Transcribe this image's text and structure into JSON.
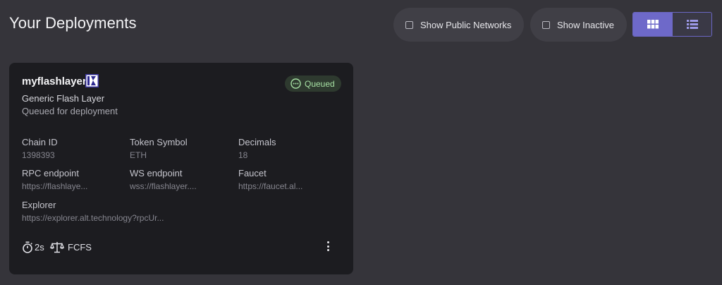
{
  "header": {
    "title": "Your Deployments",
    "show_public_label": "Show Public Networks",
    "show_inactive_label": "Show Inactive"
  },
  "card": {
    "name": "myflashlayer",
    "type": "Generic Flash Layer",
    "status_text": "Queued for deployment",
    "badge": "Queued",
    "fields": {
      "chain_id": {
        "label": "Chain ID",
        "value": "1398393"
      },
      "token_symbol": {
        "label": "Token Symbol",
        "value": "ETH"
      },
      "decimals": {
        "label": "Decimals",
        "value": "18"
      },
      "rpc": {
        "label": "RPC endpoint",
        "value": "https://flashlaye..."
      },
      "ws": {
        "label": "WS endpoint",
        "value": "wss://flashlayer...."
      },
      "faucet": {
        "label": "Faucet",
        "value": "https://faucet.al..."
      },
      "explorer": {
        "label": "Explorer",
        "value": "https://explorer.alt.technology?rpcUr..."
      }
    },
    "footer": {
      "block_time": "2s",
      "sequencing": "FCFS"
    }
  },
  "colors": {
    "background": "#35343a",
    "card": "#1c1c20",
    "accent": "#6e69c9",
    "badge_text": "#a6e0a3"
  },
  "icons": [
    "checkbox-icon",
    "grid-view-icon",
    "list-view-icon",
    "network-logo-icon",
    "queued-icon",
    "stopwatch-icon",
    "scale-icon",
    "more-vertical-icon"
  ]
}
